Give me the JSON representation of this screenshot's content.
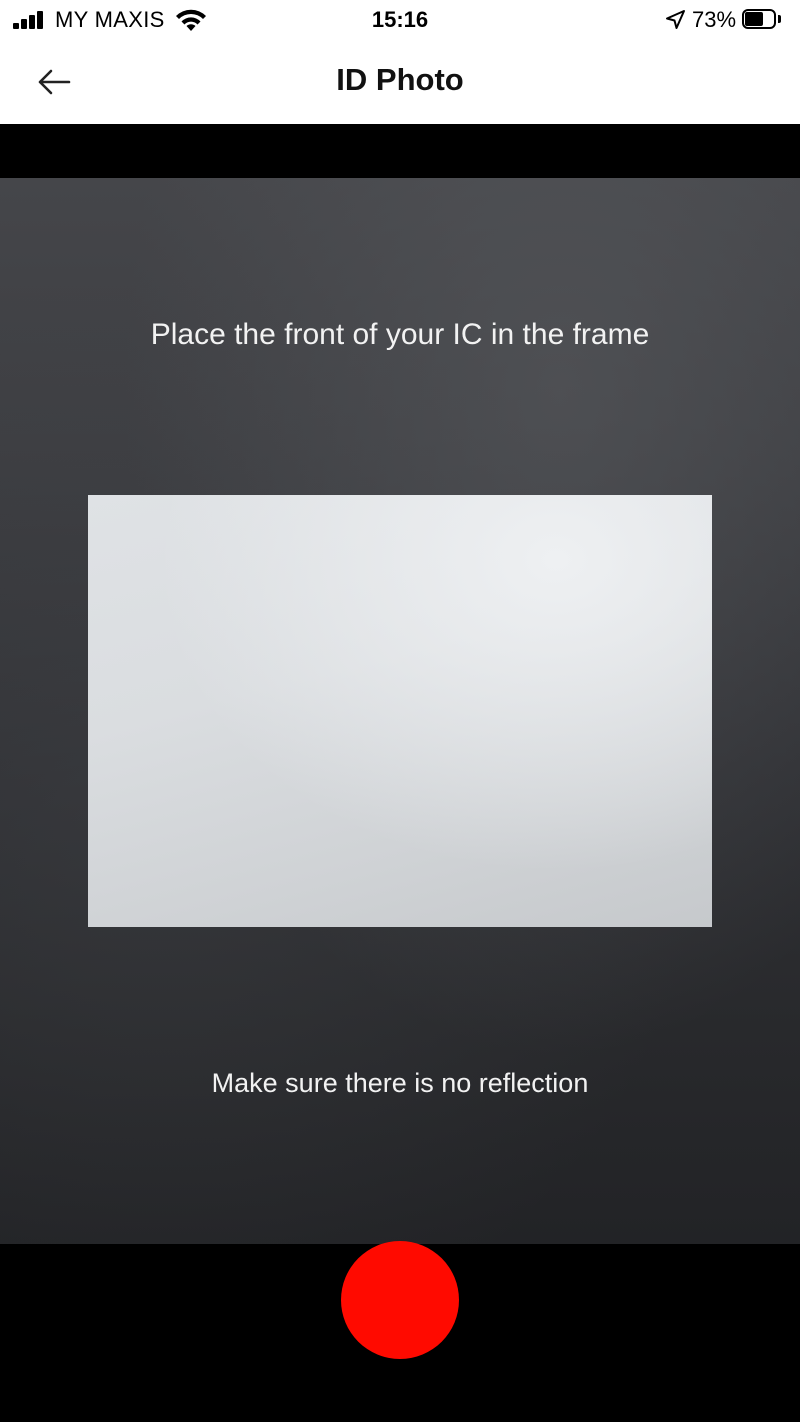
{
  "status_bar": {
    "carrier": "MY MAXIS",
    "time": "15:16",
    "battery_percent": "73%",
    "battery_level": 0.73,
    "signal_bars": 4,
    "icons": [
      "signal-icon",
      "wifi-icon",
      "location-arrow-icon",
      "battery-icon"
    ]
  },
  "nav": {
    "title": "ID Photo",
    "back_icon": "arrow-left-icon"
  },
  "camera": {
    "instruction_top": "Place the front of your IC in the frame",
    "instruction_bottom": "Make sure there is no reflection"
  },
  "capture": {
    "shutter_color": "#ff0a00"
  },
  "colors": {
    "status_bar_bg": "#ffffff",
    "capture_bar_bg": "#000000",
    "instruction_text": "#f2f2f2"
  }
}
